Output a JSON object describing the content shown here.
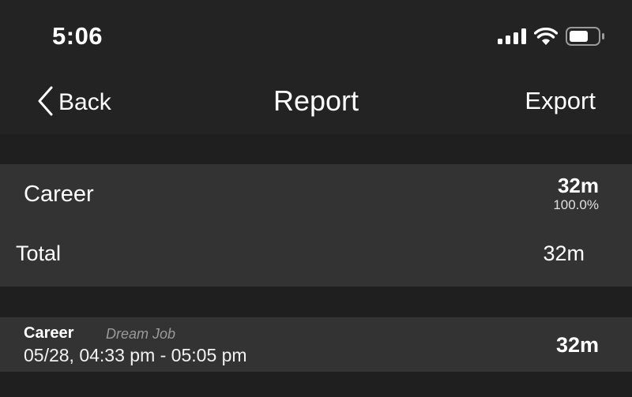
{
  "status_bar": {
    "time": "5:06",
    "icons": [
      "signal-icon",
      "wifi-icon",
      "battery-icon"
    ]
  },
  "nav": {
    "back_label": "Back",
    "title": "Report",
    "export_label": "Export"
  },
  "summary": {
    "category": {
      "name": "Career",
      "duration": "32m",
      "percent": "100.0%"
    },
    "total": {
      "label": "Total",
      "value": "32m"
    }
  },
  "entries": [
    {
      "category": "Career",
      "goal": "Dream Job",
      "range": "05/28, 04:33 pm - 05:05 pm",
      "duration": "32m"
    }
  ],
  "colors": {
    "background": "#1f1f1f",
    "bar": "#232323",
    "card": "#333333",
    "text": "#ffffff",
    "muted": "#9a9a9a"
  }
}
